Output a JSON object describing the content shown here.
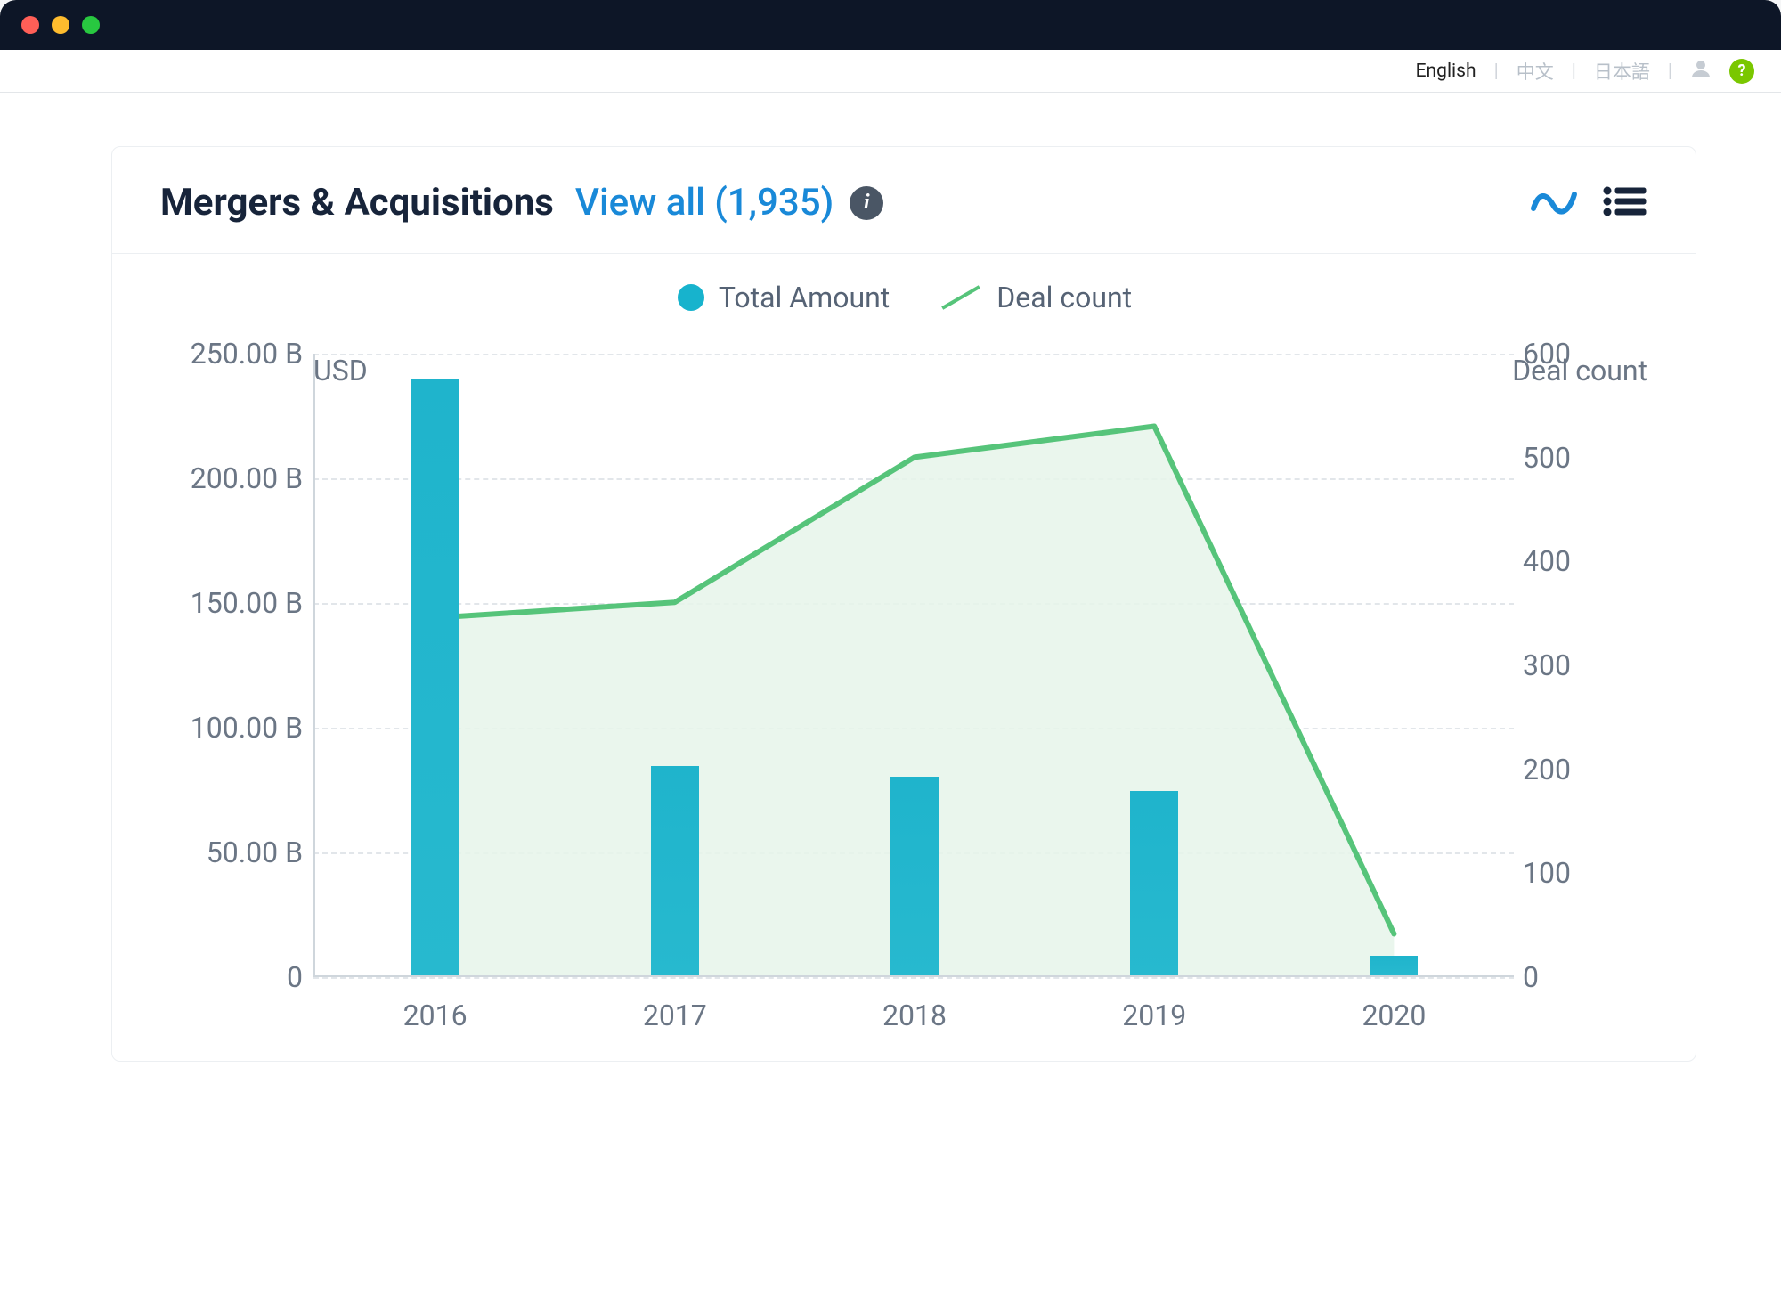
{
  "topbar": {
    "languages": [
      "English",
      "中文",
      "日本語"
    ],
    "active_language_index": 0
  },
  "card": {
    "title": "Mergers & Acquisitions",
    "view_all_label": "View all (1,935)"
  },
  "legend": {
    "series_a": "Total Amount",
    "series_b": "Deal count"
  },
  "axes": {
    "left_title": "USD",
    "right_title": "Deal count",
    "left_ticks": [
      "250.00 B",
      "200.00 B",
      "150.00 B",
      "100.00 B",
      "50.00 B",
      "0"
    ],
    "right_ticks": [
      "600",
      "500",
      "400",
      "300",
      "200",
      "100",
      "0"
    ],
    "categories": [
      "2016",
      "2017",
      "2018",
      "2019",
      "2020"
    ]
  },
  "chart_data": {
    "type": "bar+line",
    "categories": [
      "2016",
      "2017",
      "2018",
      "2019",
      "2020"
    ],
    "series": [
      {
        "name": "Total Amount",
        "axis": "left",
        "kind": "bar",
        "unit": "USD B",
        "values": [
          240,
          84,
          80,
          74,
          8
        ]
      },
      {
        "name": "Deal count",
        "axis": "right",
        "kind": "line-area",
        "values": [
          345,
          360,
          500,
          530,
          40
        ]
      }
    ],
    "left_axis": {
      "label": "USD",
      "min": 0,
      "max": 250,
      "tick_suffix": " B"
    },
    "right_axis": {
      "label": "Deal count",
      "min": 0,
      "max": 600
    },
    "title": "Mergers & Acquisitions",
    "colors": {
      "bar": "#1fb4cc",
      "line": "#56c47a",
      "area": "#e6f5ea"
    }
  }
}
